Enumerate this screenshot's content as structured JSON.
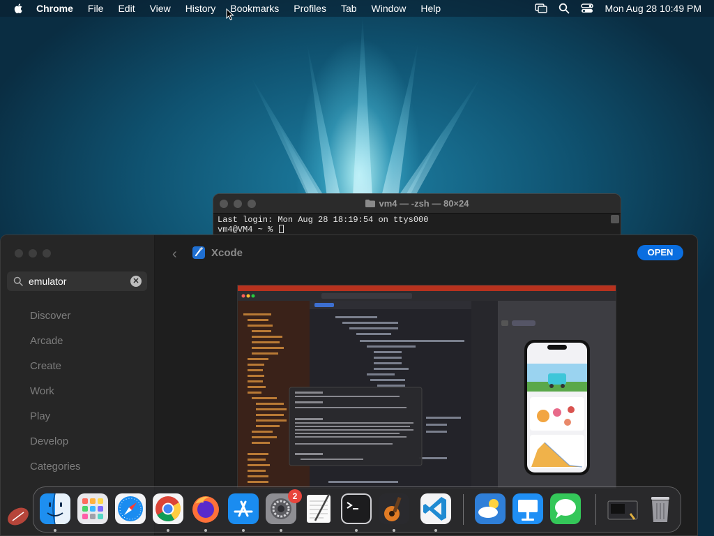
{
  "menubar": {
    "app_name": "Chrome",
    "items": [
      "File",
      "Edit",
      "View",
      "History",
      "Bookmarks",
      "Profiles",
      "Tab",
      "Window",
      "Help"
    ],
    "clock": "Mon Aug 28  10:49 PM"
  },
  "terminal": {
    "title": "vm4 — -zsh — 80×24",
    "lines": [
      "Last login: Mon Aug 28 18:19:54 on ttys000",
      "vm4@VM4 ~ % "
    ]
  },
  "appstore": {
    "search": {
      "value": "emulator"
    },
    "nav": [
      "Discover",
      "Arcade",
      "Create",
      "Work",
      "Play",
      "Develop",
      "Categories"
    ],
    "app_title": "Xcode",
    "open_label": "OPEN"
  },
  "dock": {
    "apps": [
      "Finder",
      "Launchpad",
      "Safari",
      "Google Chrome",
      "Firefox",
      "App Store",
      "System Settings",
      "TextEdit",
      "Terminal",
      "GarageBand",
      "Visual Studio Code",
      "Weather",
      "Keynote",
      "Messages",
      "Downloads",
      "Trash"
    ],
    "settings_badge": "2"
  },
  "colors": {
    "accent": "#0a6ee0",
    "badge": "#e8453c"
  }
}
